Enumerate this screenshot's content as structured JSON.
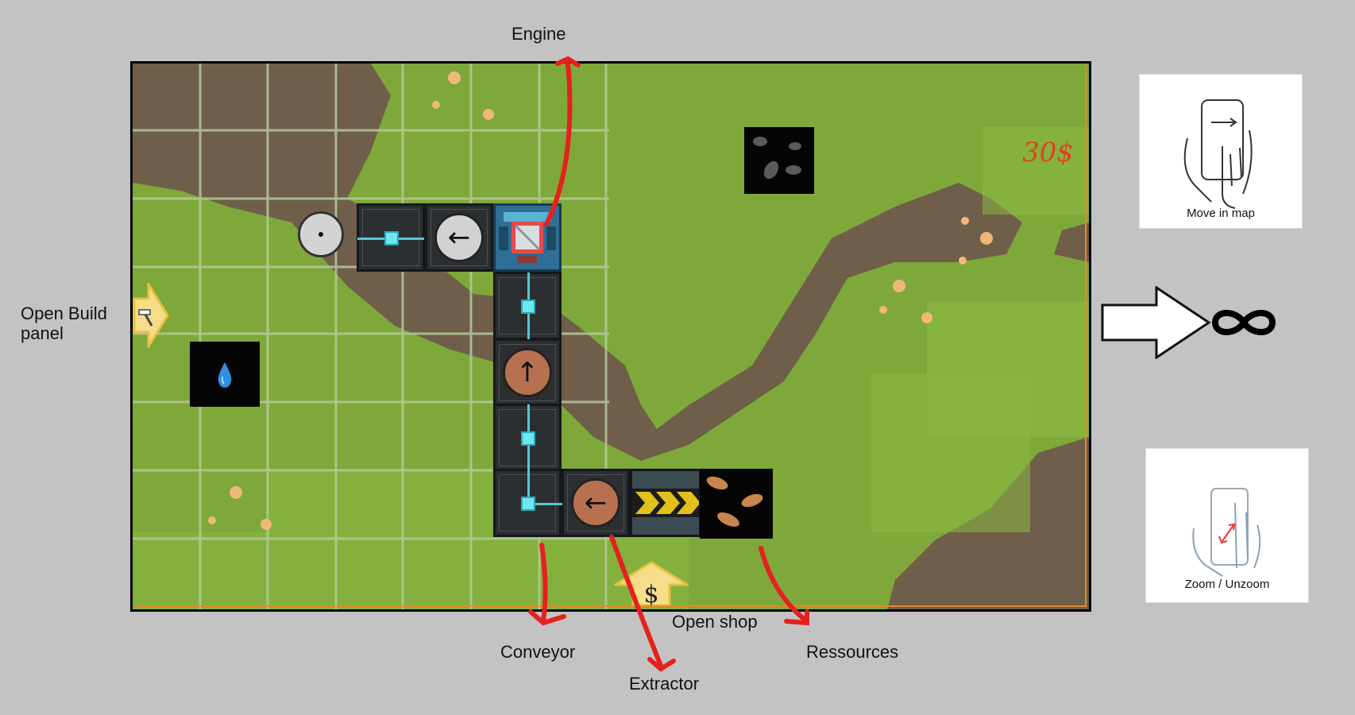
{
  "labels": {
    "engine": "Engine",
    "open_build_panel": "Open Build panel",
    "open_shop": "Open shop",
    "conveyor": "Conveyor",
    "extractor": "Extractor",
    "ressources": "Ressources"
  },
  "hud": {
    "money": "30$"
  },
  "gesture_cards": {
    "move": "Move in map",
    "zoom": "Zoom / Unzoom"
  },
  "icons": {
    "build_button": "hammer-icon",
    "shop_button": "dollar-icon",
    "infinity": "infinity-icon",
    "water_resource": "water-drop-icon",
    "ore_copper": "copper-ore-icon",
    "ore_coal": "coal-ore-icon"
  },
  "colors": {
    "grass": "#7fa83a",
    "dirt": "#6f5f4a",
    "annotation_arrow": "#e5201e",
    "button_yellow": "#f5dd8a",
    "belt_yellow": "#e2c21a",
    "wire_cyan": "#6de7f0"
  }
}
